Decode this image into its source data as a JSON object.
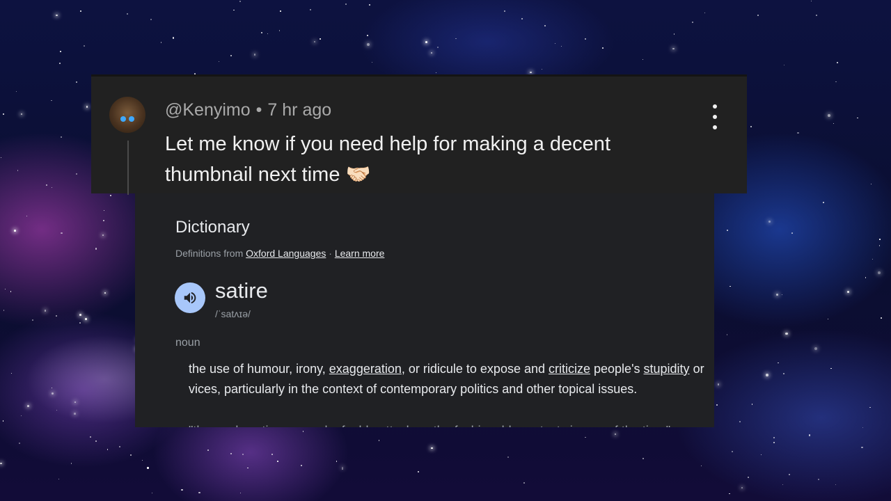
{
  "comment": {
    "username": "@Kenyimo",
    "separator": "•",
    "time_ago": "7 hr ago",
    "text": "Let me know if you need help for making a decent thumbnail next time",
    "emoji": "🤝🏻",
    "menu_icon": "more-vert-icon",
    "avatar_icon": "avatar"
  },
  "dictionary": {
    "title": "Dictionary",
    "source_prefix": "Definitions from",
    "source_link": "Oxford Languages",
    "source_sep": "·",
    "learn_more": "Learn more",
    "speaker_icon": "speaker-icon",
    "speaker_color": "#a8c7fa",
    "word": "satire",
    "phonetic": "/ˈsatʌɪə/",
    "part_of_speech": "noun",
    "definition": {
      "t1": "the use of humour, irony, ",
      "w1": "exaggeration",
      "t2": ", or ridicule to expose and ",
      "w2": "criticize",
      "t3": " people's ",
      "w3": "stupidity",
      "t4": " or vices, particularly in the context of contemporary politics and other topical issues."
    },
    "example": "\"the crude satire seemed a feeble attack on the fashionable protest singers of the time\""
  },
  "colors": {
    "card_bg": "#212121",
    "dict_bg": "#202124",
    "text_primary": "#f1f1f1",
    "text_secondary": "#aaaaaa"
  }
}
